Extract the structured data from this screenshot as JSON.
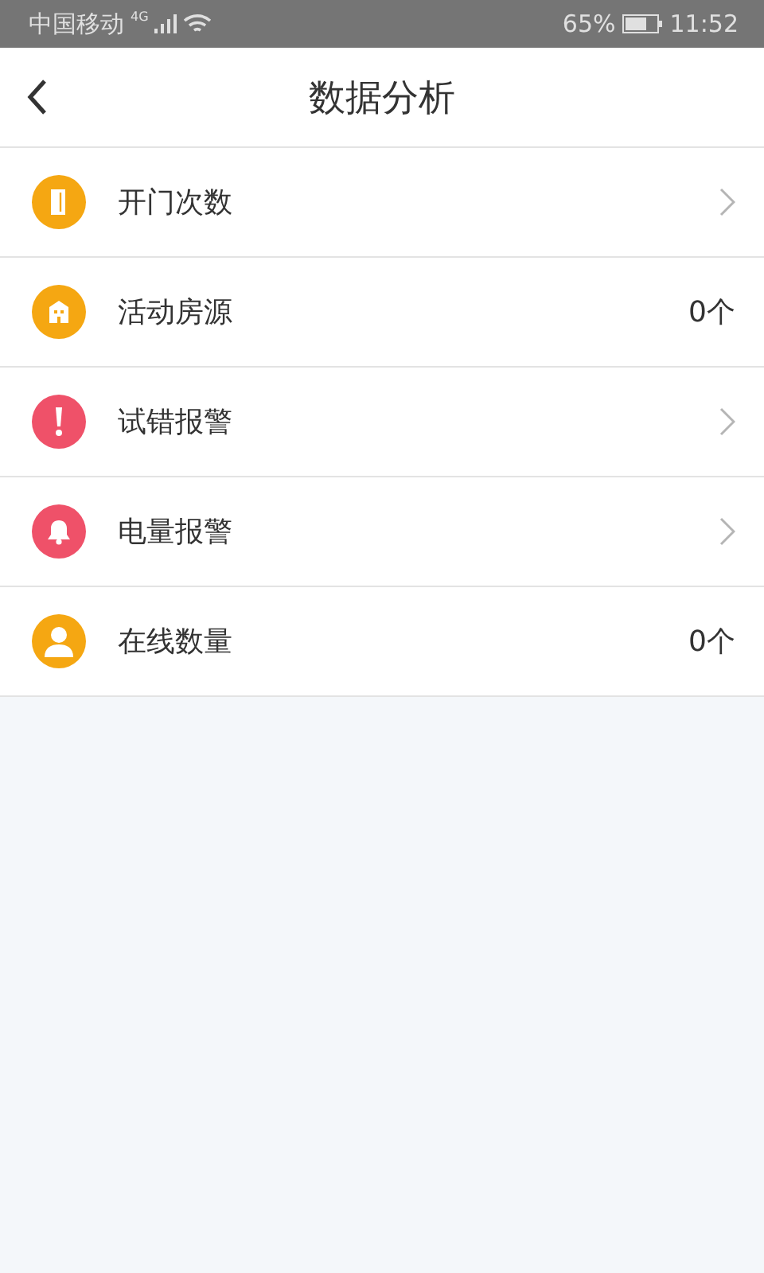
{
  "status_bar": {
    "carrier": "中国移动",
    "network": "4G",
    "battery": "65%",
    "time": "11:52"
  },
  "header": {
    "title": "数据分析"
  },
  "items": [
    {
      "label": "开门次数",
      "kind": "link",
      "color": "#f5a712"
    },
    {
      "label": "活动房源",
      "kind": "count",
      "color": "#f5a712",
      "value": "0个"
    },
    {
      "label": "试错报警",
      "kind": "link",
      "color": "#ef5169"
    },
    {
      "label": "电量报警",
      "kind": "link",
      "color": "#ef5169"
    },
    {
      "label": "在线数量",
      "kind": "count",
      "color": "#f5a712",
      "value": "0个"
    }
  ]
}
